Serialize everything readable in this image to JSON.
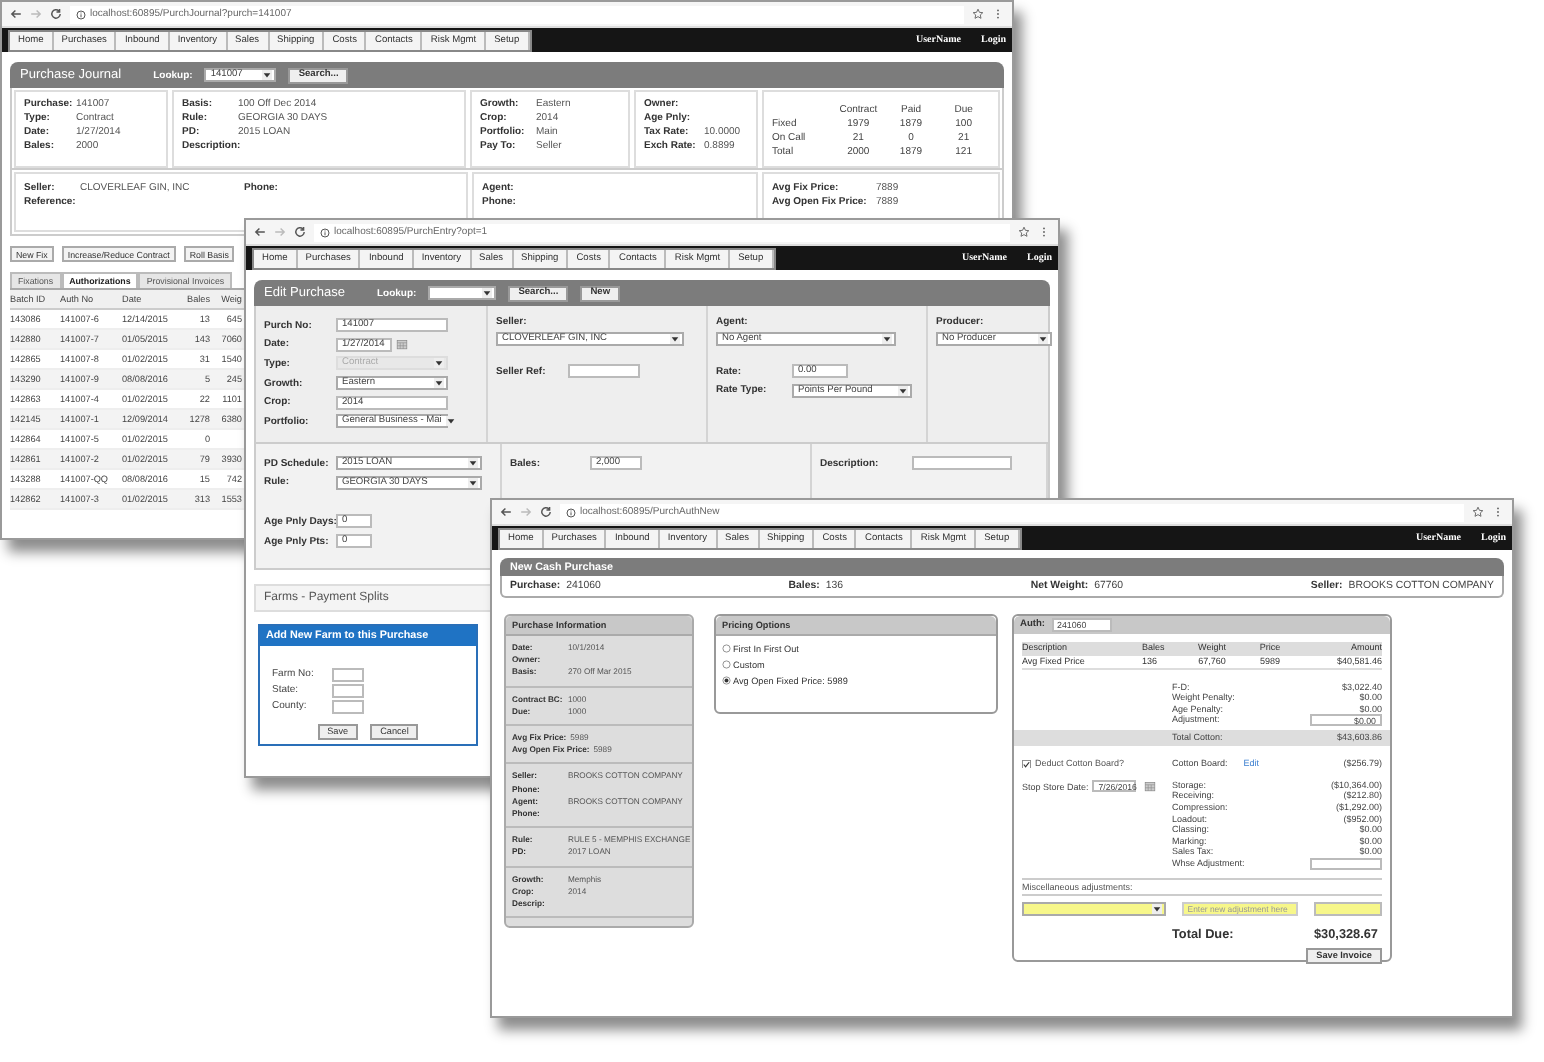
{
  "windows": [
    {
      "kind": "journal",
      "url": "localhost:60895/PurchJournal?purch=141007",
      "nav": [
        "Home",
        "Purchases",
        "Inbound",
        "Inventory",
        "Sales",
        "Shipping",
        "Costs",
        "Contacts",
        "Risk Mgmt",
        "Setup"
      ],
      "user": "UserName",
      "login": "Login",
      "title": "Purchase Journal",
      "lookup_label": "Lookup:",
      "lookup_value": "141007",
      "search_button": "Search...",
      "info_columns": [
        [
          {
            "label": "Purchase:",
            "value": "141007"
          },
          {
            "label": "Type:",
            "value": "Contract"
          },
          {
            "label": "Date:",
            "value": "1/27/2014"
          },
          {
            "label": "Bales:",
            "value": "2000"
          }
        ],
        [
          {
            "label": "Basis:",
            "value": "100 Off Dec 2014"
          },
          {
            "label": "Rule:",
            "value": "GEORGIA 30 DAYS"
          },
          {
            "label": "PD:",
            "value": "2015 LOAN"
          },
          {
            "label": "Description:"
          }
        ],
        [
          {
            "label": "Growth:",
            "value": "Eastern"
          },
          {
            "label": "Crop:",
            "value": "2014"
          },
          {
            "label": "Portfolio:",
            "value": "Main"
          },
          {
            "label": "Pay To:",
            "value": "Seller"
          }
        ],
        [
          {
            "label": "Owner:"
          },
          {
            "label": "Age Pnly:"
          },
          {
            "label": "Tax Rate:",
            "value": "10.0000"
          },
          {
            "label": "Exch Rate:",
            "value": "0.8899"
          }
        ]
      ],
      "totals": {
        "columns": [
          "Contract",
          "Paid",
          "Due"
        ],
        "rows": [
          {
            "label": "Fixed",
            "values": [
              "1979",
              "1879",
              "100"
            ]
          },
          {
            "label": "On Call",
            "values": [
              "21",
              "0",
              "21"
            ]
          },
          {
            "label": "Total",
            "values": [
              "2000",
              "1879",
              "121"
            ]
          }
        ]
      },
      "detail_columns": [
        [
          {
            "label": "Seller:",
            "value": "CLOVERLEAF GIN, INC"
          },
          {
            "label": "Phone:"
          },
          {
            "label": "Reference:"
          }
        ],
        [
          {
            "label": "Agent:"
          },
          {
            "label": "Phone:"
          }
        ],
        [
          {
            "label": "Avg Fix Price:",
            "value": "7889"
          },
          {
            "label": "Avg Open Fix Price:",
            "value": "7889"
          }
        ]
      ],
      "actions": [
        "New Fix",
        "Increase/Reduce Contract",
        "Roll Basis"
      ],
      "tabs": [
        {
          "label": "Fixations",
          "selected": false
        },
        {
          "label": "Authorizations",
          "selected": true
        },
        {
          "label": "Provisional Invoices",
          "selected": false
        }
      ],
      "table": {
        "columns": [
          "Batch ID",
          "Auth No",
          "Date",
          "Bales",
          "Weig"
        ],
        "rows": [
          [
            "143086",
            "141007-6",
            "12/14/2015",
            "13",
            "645"
          ],
          [
            "142880",
            "141007-7",
            "01/05/2015",
            "143",
            "7060"
          ],
          [
            "142865",
            "141007-8",
            "01/02/2015",
            "31",
            "1540"
          ],
          [
            "143290",
            "141007-9",
            "08/08/2016",
            "5",
            "245"
          ],
          [
            "142863",
            "141007-4",
            "01/02/2015",
            "22",
            "1101"
          ],
          [
            "142145",
            "141007-1",
            "12/09/2014",
            "1278",
            "6380"
          ],
          [
            "142864",
            "141007-5",
            "01/02/2015",
            "0"
          ],
          [
            "142861",
            "141007-2",
            "01/02/2015",
            "79",
            "3930"
          ],
          [
            "143288",
            "141007-QQ",
            "08/08/2016",
            "15",
            "742"
          ],
          [
            "142862",
            "141007-3",
            "01/02/2015",
            "313",
            "1553"
          ]
        ]
      }
    },
    {
      "kind": "entry",
      "url": "localhost:60895/PurchEntry?opt=1",
      "nav": [
        "Home",
        "Purchases",
        "Inbound",
        "Inventory",
        "Sales",
        "Shipping",
        "Costs",
        "Contacts",
        "Risk Mgmt",
        "Setup"
      ],
      "user": "UserName",
      "login": "Login",
      "title": "Edit Purchase",
      "lookup_label": "Lookup:",
      "search_button": "Search...",
      "new_button": "New",
      "main_columns": [
        [
          {
            "label": "Purch No:",
            "value": "141007",
            "kind": "text",
            "disabled": false
          },
          {
            "label": "Date:",
            "value": "1/27/2014",
            "kind": "date",
            "disabled": false
          },
          {
            "label": "Type:",
            "value": "Contract",
            "kind": "select",
            "disabled": true
          },
          {
            "label": "Growth:",
            "value": "Eastern",
            "kind": "select",
            "disabled": false
          },
          {
            "label": "Crop:",
            "value": "2014",
            "kind": "text",
            "disabled": false
          },
          {
            "label": "Portfolio:",
            "value": "General Business - Mai",
            "kind": "select",
            "disabled": false
          }
        ],
        [
          {
            "label": "Seller:",
            "value": "CLOVERLEAF GIN, INC",
            "kind": "stacked_select",
            "disabled": false
          },
          {
            "label": "Seller Ref:",
            "kind": "text",
            "disabled": false
          }
        ],
        [
          {
            "label": "Agent:",
            "value": "No Agent",
            "kind": "stacked_select",
            "disabled": false
          },
          {
            "label": "Rate:",
            "value": "0.00",
            "kind": "text",
            "disabled": false
          },
          {
            "label": "Rate Type:",
            "value": "Points Per Pound",
            "kind": "select",
            "disabled": false
          }
        ],
        [
          {
            "label": "Producer:",
            "value": "No Producer",
            "kind": "stacked_select",
            "disabled": false
          }
        ]
      ],
      "schedule_columns": [
        [
          {
            "label": "PD Schedule:",
            "value": "2015 LOAN",
            "kind": "select",
            "disabled": false
          },
          {
            "label": "Rule:",
            "value": "GEORGIA 30 DAYS",
            "kind": "select",
            "disabled": false
          },
          {
            "label": "Age Pnly Days:",
            "value": "0",
            "kind": "text",
            "disabled": false
          },
          {
            "label": "Age Pnly Pts:",
            "value": "0",
            "kind": "text",
            "disabled": false
          }
        ],
        [
          {
            "label": "Bales:",
            "value": "2,000",
            "kind": "text",
            "disabled": false
          }
        ],
        [
          {
            "label": "Description:",
            "kind": "text",
            "disabled": false
          }
        ]
      ],
      "farms_heading": "Farms - Payment Splits",
      "dialog": {
        "title": "Add New Farm to this Purchase",
        "fields": [
          "Farm No:",
          "State:",
          "County:"
        ],
        "buttons": [
          "Save",
          "Cancel"
        ]
      }
    },
    {
      "kind": "cash",
      "url": "localhost:60895/PurchAuthNew",
      "nav": [
        "Home",
        "Purchases",
        "Inbound",
        "Inventory",
        "Sales",
        "Shipping",
        "Costs",
        "Contacts",
        "Risk Mgmt",
        "Setup"
      ],
      "user": "UserName",
      "login": "Login",
      "title": "New Cash Purchase",
      "summary": [
        {
          "label": "Purchase:",
          "value": "241060"
        },
        {
          "label": "Bales:",
          "value": "136"
        },
        {
          "label": "Net Weight:",
          "value": "67760"
        },
        {
          "label": "Seller:",
          "value": "BROOKS COTTON COMPANY"
        }
      ],
      "info": {
        "title": "Purchase Information",
        "groups": [
          [
            {
              "label": "Date:",
              "value": "10/1/2014"
            },
            {
              "label": "Owner:"
            },
            {
              "label": "Basis:",
              "value": "270 Off Mar 2015"
            }
          ],
          [
            {
              "label": "Contract BC:",
              "value": "1000"
            },
            {
              "label": "Due:",
              "value": "1000"
            }
          ],
          [
            {
              "label": "Avg Fix Price:",
              "value": "5989"
            },
            {
              "label": "Avg Open Fix Price:",
              "value": "5989"
            }
          ],
          [
            {
              "label": "Seller:",
              "value": "BROOKS COTTON COMPANY"
            },
            {
              "label": "Phone:"
            },
            {
              "label": "Agent:",
              "value": "BROOKS COTTON COMPANY"
            },
            {
              "label": "Phone:"
            }
          ],
          [
            {
              "label": "Rule:",
              "value": "RULE 5 - MEMPHIS EXCHANGE"
            },
            {
              "label": "PD:",
              "value": "2017 LOAN"
            }
          ],
          [
            {
              "label": "Growth:",
              "value": "Memphis"
            },
            {
              "label": "Crop:",
              "value": "2014"
            },
            {
              "label": "Descrip:"
            }
          ]
        ]
      },
      "pricing": {
        "title": "Pricing Options",
        "options": [
          {
            "label": "First In First Out",
            "selected": false
          },
          {
            "label": "Custom",
            "selected": false
          },
          {
            "label": "Avg Open Fixed Price: 5989",
            "selected": true
          }
        ]
      },
      "auth": {
        "label": "Auth:",
        "value": "241060",
        "columns": [
          "Description",
          "Bales",
          "Weight",
          "Price",
          "Amount"
        ],
        "rows": [
          [
            "Avg Fixed Price",
            "136",
            "67,760",
            "5989",
            "$40,581.46"
          ]
        ],
        "charges": [
          {
            "label": "F-D:",
            "amount": "$3,022.40",
            "kind": "text"
          },
          {
            "label": "Weight Penalty:",
            "amount": "$0.00",
            "kind": "text"
          },
          {
            "label": "Age Penalty:",
            "amount": "$0.00",
            "kind": "text"
          },
          {
            "label": "Adjustment:",
            "amount": "$0.00",
            "kind": "input"
          }
        ],
        "total_cotton": {
          "label": "Total Cotton:",
          "amount": "$43,603.86"
        },
        "deduct": {
          "label": "Deduct Cotton Board?",
          "checked": true
        },
        "cotton_board": {
          "label": "Cotton Board:",
          "link": "Edit",
          "amount": "($256.79)"
        },
        "stop_store": {
          "label": "Stop Store Date:",
          "value": "7/26/2016"
        },
        "fees": [
          {
            "label": "Storage:",
            "amount": "($10,364.00)",
            "kind": "text"
          },
          {
            "label": "Receiving:",
            "amount": "($212.80)",
            "kind": "text"
          },
          {
            "label": "Compression:",
            "amount": "($1,292.00)",
            "kind": "text"
          },
          {
            "label": "Loadout:",
            "amount": "($952.00)",
            "kind": "text"
          },
          {
            "label": "Classing:",
            "amount": "$0.00",
            "kind": "text"
          },
          {
            "label": "Marking:",
            "amount": "$0.00",
            "kind": "text"
          },
          {
            "label": "Sales Tax:",
            "amount": "$0.00",
            "kind": "text"
          },
          {
            "label": "Whse Adjustment:",
            "kind": "input"
          }
        ],
        "misc_label": "Miscellaneous adjustments:",
        "misc_placeholder": "Enter new adjustment here",
        "total_due_label": "Total Due:",
        "total_due": "$30,328.67",
        "save_button": "Save Invoice"
      }
    }
  ]
}
